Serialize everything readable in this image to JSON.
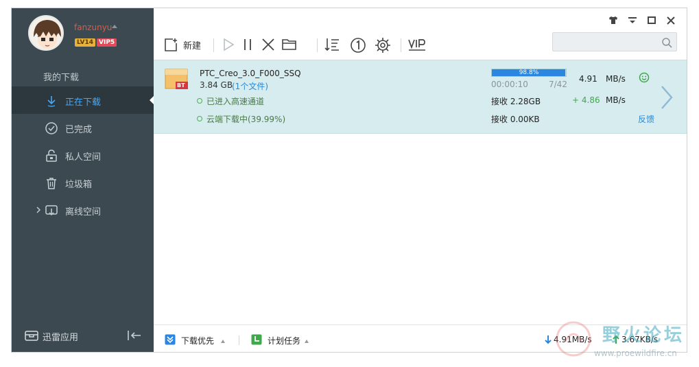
{
  "colors": {
    "sidebar_bg": "#3d4950",
    "sidebar_active_bg": "#2d383e",
    "accent_blue": "#4aa6f0",
    "task_row_bg": "#d6ecee",
    "progress_fill": "#2a86de",
    "speed_gain_green": "#3ea84a",
    "username_red": "#e8553b"
  },
  "profile": {
    "username": "fanzunyu",
    "level_badge": "LV14",
    "vip_badge": "VIP5",
    "avatar_icon": "user-avatar-icon"
  },
  "sidebar": {
    "section_title": "我的下载",
    "items": [
      {
        "label": "正在下载",
        "icon": "download-arrow-icon",
        "active": true
      },
      {
        "label": "已完成",
        "icon": "check-circle-icon",
        "active": false
      },
      {
        "label": "私人空间",
        "icon": "lock-icon",
        "active": false
      },
      {
        "label": "垃圾箱",
        "icon": "trash-icon",
        "active": false
      },
      {
        "label": "离线空间",
        "icon": "cloud-download-icon",
        "active": false,
        "expandable": true
      }
    ],
    "footer": {
      "apps_label": "迅雷应用",
      "apps_icon": "apps-box-icon",
      "collapse_icon": "collapse-sidebar-icon"
    }
  },
  "window_controls": [
    "skin-icon",
    "menu-icon",
    "maximize-icon",
    "close-icon"
  ],
  "toolbar": {
    "new_label": "新建",
    "buttons": [
      "new-task-icon",
      "start-icon",
      "pause-icon",
      "delete-icon",
      "open-folder-icon",
      "sort-icon",
      "one-task-icon",
      "settings-icon",
      "vip-icon"
    ],
    "search_placeholder": ""
  },
  "task": {
    "name": "PTC_Creo_3.0_F000_SSQ",
    "size": "3.84 GB",
    "files": "(1个文件)",
    "file_badge": "BT",
    "status_line_1": "已进入高速通道",
    "status_line_2": "云端下载中(39.99%)",
    "progress_percent": 98.8,
    "progress_label": "98.8%",
    "elapsed": "00:00:10",
    "pieces": "7/42",
    "speed_value": "4.91",
    "speed_unit": "MB/s",
    "received_1": "接收 2.28GB",
    "accel_value": "+ 4.86",
    "accel_unit": "MB/s",
    "received_2": "接收 0.00KB",
    "feedback": "反馈"
  },
  "bottom": {
    "priority_label": "下载优先",
    "schedule_label": "计划任务",
    "download_rate": "4.91MB/s",
    "upload_rate": "3.67KB/s"
  },
  "watermark": {
    "title": "野火论坛",
    "url": "www.proewildfire.cn"
  }
}
